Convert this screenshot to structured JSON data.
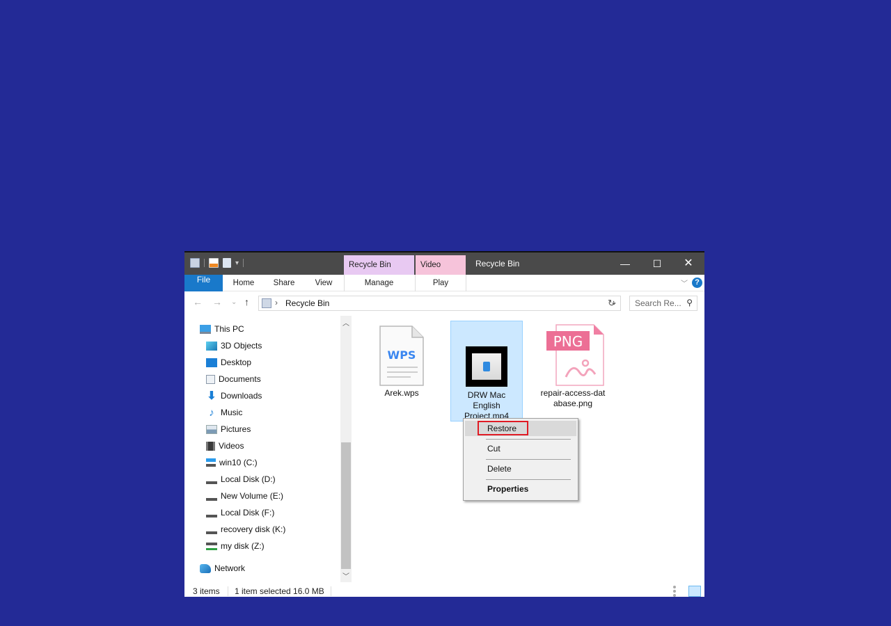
{
  "window": {
    "title": "Recycle Bin",
    "context_tabs": [
      "Recycle Bin Tools",
      "Video Tools"
    ],
    "controls": {
      "minimize": "—",
      "maximize": "☐",
      "close": "✕"
    }
  },
  "ribbon": {
    "tabs": [
      "File",
      "Home",
      "Share",
      "View",
      "Manage",
      "Play"
    ],
    "help": "?"
  },
  "navbar": {
    "back": "←",
    "forward": "→",
    "recent": "⌄",
    "up": "↑",
    "breadcrumb": [
      "Recycle Bin"
    ],
    "search_placeholder": "Search Re...",
    "refresh": "↻"
  },
  "navpane": {
    "items": [
      {
        "label": "This PC",
        "icon": "computer-icon",
        "level": 0
      },
      {
        "label": "3D Objects",
        "icon": "3d-objects-icon",
        "level": 1
      },
      {
        "label": "Desktop",
        "icon": "desktop-icon",
        "level": 1
      },
      {
        "label": "Documents",
        "icon": "documents-icon",
        "level": 1
      },
      {
        "label": "Downloads",
        "icon": "downloads-icon",
        "level": 1
      },
      {
        "label": "Music",
        "icon": "music-icon",
        "level": 1
      },
      {
        "label": "Pictures",
        "icon": "pictures-icon",
        "level": 1
      },
      {
        "label": "Videos",
        "icon": "videos-icon",
        "level": 1
      },
      {
        "label": "win10 (C:)",
        "icon": "system-drive-icon",
        "level": 1
      },
      {
        "label": "Local Disk (D:)",
        "icon": "drive-icon",
        "level": 1
      },
      {
        "label": "New Volume (E:)",
        "icon": "drive-icon",
        "level": 1
      },
      {
        "label": "Local Disk (F:)",
        "icon": "drive-icon",
        "level": 1
      },
      {
        "label": "recovery disk (K:)",
        "icon": "drive-icon",
        "level": 1
      },
      {
        "label": "my disk (Z:)",
        "icon": "network-drive-icon",
        "level": 1
      },
      {
        "label": "Network",
        "icon": "network-icon",
        "level": 0
      }
    ]
  },
  "files": [
    {
      "name_lines": [
        "Arek.wps"
      ],
      "type": "wps",
      "badge": "WPS",
      "selected": false
    },
    {
      "name_lines": [
        "DRW Mac",
        "English",
        "Project.mp4"
      ],
      "type": "video",
      "selected": true
    },
    {
      "name_lines": [
        "repair-access-dat",
        "abase.png"
      ],
      "type": "png",
      "badge": "PNG",
      "selected": false
    }
  ],
  "context_menu": {
    "items": [
      "Restore",
      "Cut",
      "Delete",
      "Properties"
    ],
    "highlighted": "Restore"
  },
  "status": {
    "count": "3 items",
    "selection": "1 item selected  16.0 MB"
  },
  "colors": {
    "background": "#232a96",
    "accent": "#1979ca",
    "selection": "#cce8ff",
    "highlight_box": "#e01b24"
  }
}
